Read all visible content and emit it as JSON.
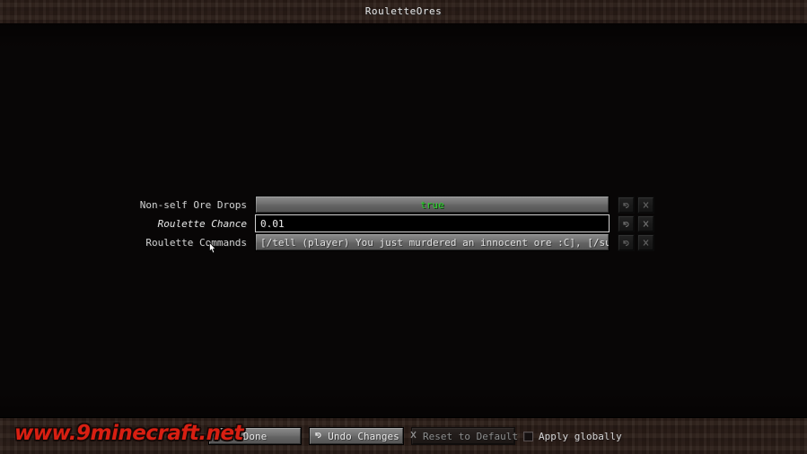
{
  "window": {
    "title": "RouletteOres"
  },
  "config_rows": [
    {
      "label": "Non-self Ore Drops",
      "type": "boolean-button",
      "value": "true",
      "modified": false,
      "undo_icon": "undo-arrow-icon",
      "reset_icon": "reset-cross-icon"
    },
    {
      "label": "Roulette Chance",
      "type": "text-field",
      "value": "0.01",
      "modified": true,
      "undo_icon": "undo-arrow-icon",
      "reset_icon": "reset-cross-icon"
    },
    {
      "label": "Roulette Commands",
      "type": "list-button",
      "value": "[/tell (player) You just murdered an innocent ore :C], [/summon Creepe…",
      "modified": false,
      "undo_icon": "undo-arrow-icon",
      "reset_icon": "reset-cross-icon"
    }
  ],
  "bottom_bar": {
    "done_label": "Done",
    "undo_label": "Undo Changes",
    "undo_icon": "undo-arrow-icon",
    "reset_label": "Reset to Default",
    "reset_icon": "reset-cross-icon",
    "reset_disabled": true,
    "apply_globally_label": "Apply globally",
    "apply_globally_checked": false
  },
  "watermark": {
    "text": "www.9minecraft.net"
  },
  "colors": {
    "true_value": "#2fd12f",
    "watermark": "#d81f12",
    "dirt": "#2a1d17",
    "button_face": "#6f6f6f"
  }
}
